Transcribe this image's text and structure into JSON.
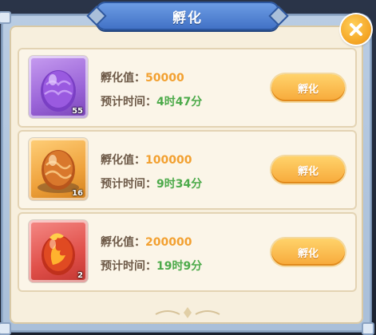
{
  "dialog": {
    "title": "孵化",
    "close_icon": "close-icon"
  },
  "eggs": [
    {
      "icon": "purple-egg-icon",
      "color": "#8b58d6",
      "count": "55",
      "hatch_label": "孵化值：",
      "hatch_value": "50000",
      "time_label": "预计时间：",
      "time_value": "4时47分",
      "button_label": "孵化"
    },
    {
      "icon": "orange-egg-icon",
      "color": "#e39a2e",
      "count": "16",
      "hatch_label": "孵化值：",
      "hatch_value": "100000",
      "time_label": "预计时间：",
      "time_value": "9时34分",
      "button_label": "孵化"
    },
    {
      "icon": "red-phoenix-egg-icon",
      "color": "#d8403a",
      "count": "2",
      "hatch_label": "孵化值：",
      "hatch_value": "200000",
      "time_label": "预计时间：",
      "time_value": "19时9分",
      "button_label": "孵化"
    }
  ],
  "colors": {
    "hatch_value": "#f2a030",
    "time_value": "#4caa4a",
    "button": "#f7a93a",
    "title_banner": "#4f7fd2"
  }
}
